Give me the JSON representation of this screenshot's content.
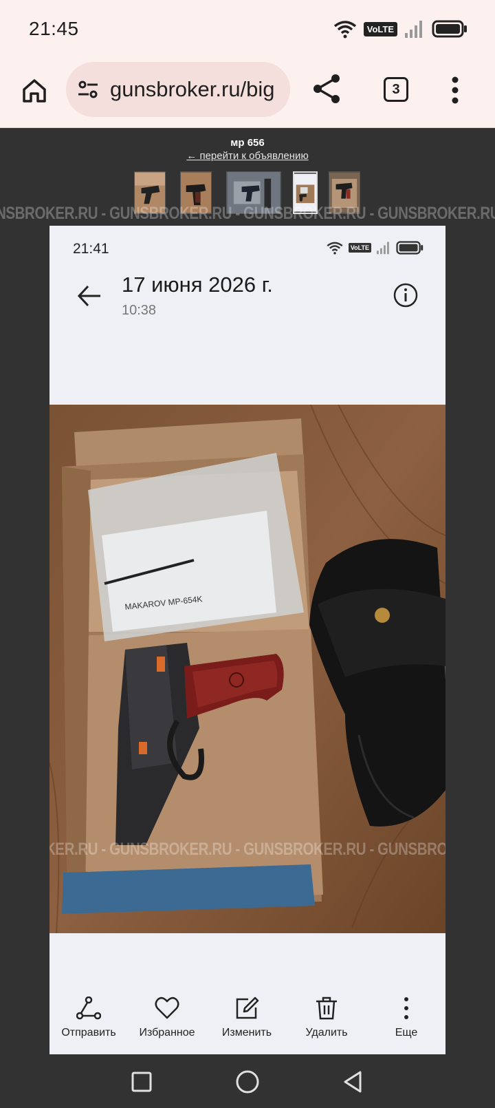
{
  "status": {
    "time": "21:45",
    "volte": "VoLTE"
  },
  "browser": {
    "url": "gunsbroker.ru/big",
    "tab_count": "3"
  },
  "listing": {
    "title": "мр 656",
    "back_link": "← перейти к объявлению",
    "watermark": "NSBROKER.RU - GUNSBROKER.RU - GUNSBROKER.RU - GUNSBROKER.RU - GUNSBROKER.RU"
  },
  "screenshot": {
    "time": "21:41",
    "volte": "VoLTE",
    "date": "17 июня 2026 г.",
    "clock": "10:38",
    "actions": [
      {
        "label": "Отправить",
        "icon": "share-icon"
      },
      {
        "label": "Избранное",
        "icon": "heart-icon"
      },
      {
        "label": "Изменить",
        "icon": "edit-icon"
      },
      {
        "label": "Удалить",
        "icon": "trash-icon"
      },
      {
        "label": "Еще",
        "icon": "more-icon"
      }
    ]
  }
}
